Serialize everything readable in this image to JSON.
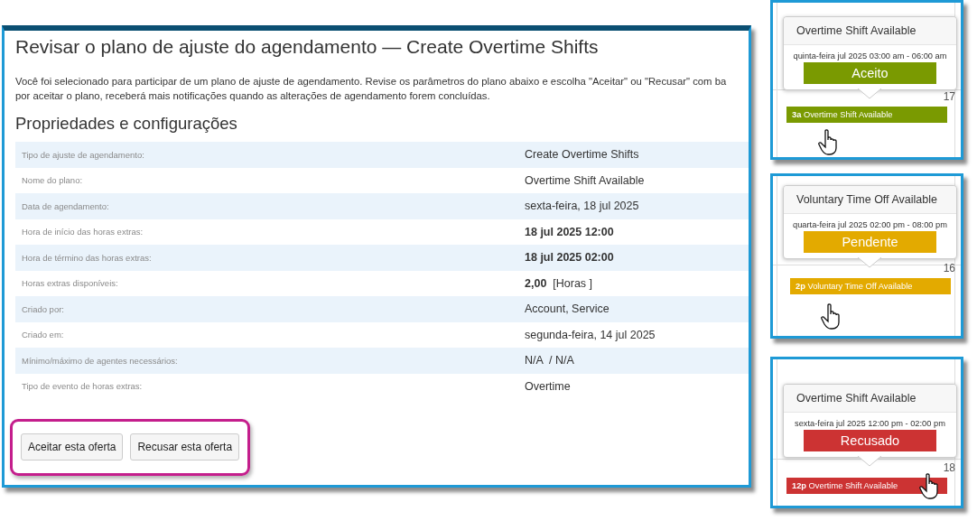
{
  "main": {
    "title": "Revisar o plano de ajuste do agendamento — Create Overtime Shifts",
    "description": "Você foi selecionado para participar de um plano de ajuste de agendamento. Revise os parâmetros do plano abaixo e escolha \"Aceitar\" ou \"Recusar\" com ba\npor aceitar o plano, receberá mais notificações quando as alterações de agendamento forem concluídas.",
    "section_title": "Propriedades e configurações",
    "rows": [
      {
        "label": "Tipo de ajuste de agendamento:",
        "value": "Create Overtime Shifts",
        "bold": false
      },
      {
        "label": "Nome do plano:",
        "value": "Overtime Shift Available",
        "bold": false
      },
      {
        "label": "Data de agendamento:",
        "value": "sexta-feira, 18 jul 2025",
        "bold": false
      },
      {
        "label": "Hora de início das horas extras:",
        "value": "18 jul 2025 12:00",
        "bold": true
      },
      {
        "label": "Hora de término das horas extras:",
        "value": "18 jul 2025 02:00",
        "bold": true
      },
      {
        "label": "Horas extras disponíveis:",
        "value": "**2,00**  [Horas ]",
        "bold": false
      },
      {
        "label": "Criado por:",
        "value": "Account, Service",
        "bold": false
      },
      {
        "label": "Criado em:",
        "value": "segunda-feira, 14 jul 2025",
        "bold": false
      },
      {
        "label": "Mínimo/máximo de agentes necessários:",
        "value": "N/A  / N/A",
        "bold": false
      },
      {
        "label": "Tipo de evento de horas extras:",
        "value": "Overtime",
        "bold": false
      }
    ],
    "buttons": [
      "Aceitar esta oferta",
      "Recusar esta oferta"
    ]
  },
  "cards": [
    {
      "popover_title": "Overtime Shift Available",
      "time": "quinta-feira jul 2025 03:00 am - 06:00 am",
      "status": "Aceito",
      "color": "#7a9a01",
      "day": "17",
      "event_time": "3a",
      "event_title": "Overtime Shift Available"
    },
    {
      "popover_title": "Voluntary Time Off Available",
      "time": "quarta-feira jul 2025 02:00 pm - 08:00 pm",
      "status": "Pendente",
      "color": "#e3aa00",
      "day": "16",
      "event_time": "2p",
      "event_title": "Voluntary Time Off Available"
    },
    {
      "popover_title": "Overtime Shift Available",
      "time": "sexta-feira jul 2025 12:00 pm - 02:00 pm",
      "status": "Recusado",
      "color": "#cc3333",
      "day": "18",
      "event_time": "12p",
      "event_title": "Overtime Shift Available"
    }
  ]
}
